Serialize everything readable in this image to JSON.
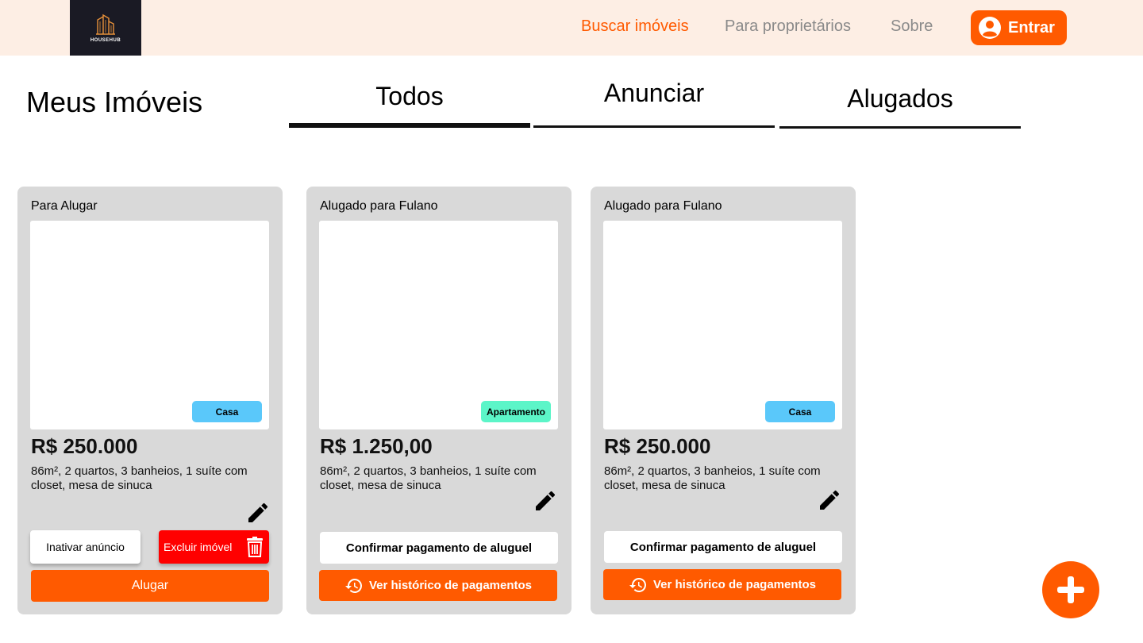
{
  "header": {
    "logo_text": "HOUSEHUB",
    "nav": [
      {
        "label": "Buscar imóveis"
      },
      {
        "label": "Para proprietários"
      },
      {
        "label": "Sobre"
      }
    ],
    "login_label": "Entrar"
  },
  "page": {
    "title": "Meus Imóveis",
    "tabs": [
      {
        "label": "Todos"
      },
      {
        "label": "Anunciar"
      },
      {
        "label": "Alugados"
      }
    ]
  },
  "cards": [
    {
      "status": "Para Alugar",
      "type": "Casa",
      "price": "R$ 250.000",
      "description": "86m², 2 quartos, 3 banheios, 1 suíte com closet, mesa de sinuca",
      "inactivate_label": "Inativar anúncio",
      "delete_label": "Excluir imóvel",
      "rent_label": "Alugar"
    },
    {
      "status": "Alugado para Fulano",
      "type": "Apartamento",
      "price": "R$ 1.250,00",
      "description": "86m², 2 quartos, 3 banheios, 1 suíte com closet, mesa de sinuca",
      "confirm_label": "Confirmar pagamento de aluguel",
      "history_label": "Ver histórico de pagamentos"
    },
    {
      "status": "Alugado para Fulano",
      "type": "Casa",
      "price": "R$ 250.000",
      "description": "86m², 2 quartos, 3 banheios, 1 suíte com closet, mesa de sinuca",
      "confirm_label": "Confirmar pagamento de aluguel",
      "history_label": "Ver histórico de pagamentos"
    }
  ],
  "colors": {
    "accent": "#ff5a00",
    "nav_bg": "#fdeee4",
    "card_bg": "#d9d9d9",
    "badge_casa": "#5ac8fa",
    "badge_apartamento": "#5cf5c8",
    "danger": "#ff0000"
  },
  "icons": {
    "user": "user-circle-icon",
    "edit": "pencil-icon",
    "delete": "trash-icon",
    "history": "history-icon",
    "add": "plus-icon"
  }
}
